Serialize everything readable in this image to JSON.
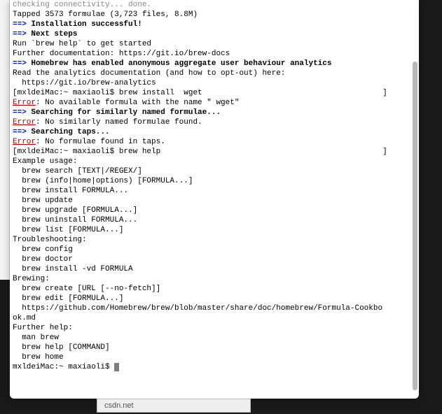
{
  "lines": [
    {
      "segs": [
        {
          "cls": "gray",
          "text": "checking connectivity... done."
        }
      ]
    },
    {
      "segs": [
        {
          "cls": "",
          "text": "Tapped 3573 formulae (3,723 files, 8.8M)"
        }
      ]
    },
    {
      "segs": [
        {
          "cls": "blue-bold",
          "text": "==> "
        },
        {
          "cls": "bold",
          "text": "Installation successful!"
        }
      ]
    },
    {
      "segs": [
        {
          "cls": "blue-bold",
          "text": "==> "
        },
        {
          "cls": "bold",
          "text": "Next steps"
        }
      ]
    },
    {
      "segs": [
        {
          "cls": "",
          "text": "Run `brew help` to get started"
        }
      ]
    },
    {
      "segs": [
        {
          "cls": "",
          "text": "Further documentation: https://git.io/brew-docs"
        }
      ]
    },
    {
      "segs": [
        {
          "cls": "blue-bold",
          "text": "==> "
        },
        {
          "cls": "bold",
          "text": "Homebrew has enabled anonymous aggregate user behaviour analytics"
        }
      ]
    },
    {
      "segs": [
        {
          "cls": "",
          "text": "Read the analytics documentation (and how to opt-out) here:"
        }
      ]
    },
    {
      "segs": [
        {
          "cls": "",
          "text": "  https://git.io/brew-analytics"
        }
      ]
    },
    {
      "segs": [
        {
          "cls": "",
          "text": "[mxldeiMac:~ maxiaoli$ brew install  wget                                       ]"
        }
      ]
    },
    {
      "segs": [
        {
          "cls": "err",
          "text": "Error"
        },
        {
          "cls": "",
          "text": ": No available formula with the name \" wget\" "
        }
      ]
    },
    {
      "segs": [
        {
          "cls": "blue-bold",
          "text": "==> "
        },
        {
          "cls": "bold",
          "text": "Searching for similarly named formulae..."
        }
      ]
    },
    {
      "segs": [
        {
          "cls": "err",
          "text": "Error"
        },
        {
          "cls": "",
          "text": ": No similarly named formulae found."
        }
      ]
    },
    {
      "segs": [
        {
          "cls": "blue-bold",
          "text": "==> "
        },
        {
          "cls": "bold",
          "text": "Searching taps..."
        }
      ]
    },
    {
      "segs": [
        {
          "cls": "err",
          "text": "Error"
        },
        {
          "cls": "",
          "text": ": No formulae found in taps."
        }
      ]
    },
    {
      "segs": [
        {
          "cls": "",
          "text": "[mxldeiMac:~ maxiaoli$ brew help                                                ]"
        }
      ]
    },
    {
      "segs": [
        {
          "cls": "",
          "text": "Example usage:"
        }
      ]
    },
    {
      "segs": [
        {
          "cls": "",
          "text": "  brew search [TEXT|/REGEX/]"
        }
      ]
    },
    {
      "segs": [
        {
          "cls": "",
          "text": "  brew (info|home|options) [FORMULA...]"
        }
      ]
    },
    {
      "segs": [
        {
          "cls": "",
          "text": "  brew install FORMULA..."
        }
      ]
    },
    {
      "segs": [
        {
          "cls": "",
          "text": "  brew update"
        }
      ]
    },
    {
      "segs": [
        {
          "cls": "",
          "text": "  brew upgrade [FORMULA...]"
        }
      ]
    },
    {
      "segs": [
        {
          "cls": "",
          "text": "  brew uninstall FORMULA..."
        }
      ]
    },
    {
      "segs": [
        {
          "cls": "",
          "text": "  brew list [FORMULA...]"
        }
      ]
    },
    {
      "segs": [
        {
          "cls": "",
          "text": ""
        }
      ]
    },
    {
      "segs": [
        {
          "cls": "",
          "text": "Troubleshooting:"
        }
      ]
    },
    {
      "segs": [
        {
          "cls": "",
          "text": "  brew config"
        }
      ]
    },
    {
      "segs": [
        {
          "cls": "",
          "text": "  brew doctor"
        }
      ]
    },
    {
      "segs": [
        {
          "cls": "",
          "text": "  brew install -vd FORMULA"
        }
      ]
    },
    {
      "segs": [
        {
          "cls": "",
          "text": ""
        }
      ]
    },
    {
      "segs": [
        {
          "cls": "",
          "text": "Brewing:"
        }
      ]
    },
    {
      "segs": [
        {
          "cls": "",
          "text": "  brew create [URL [--no-fetch]]"
        }
      ]
    },
    {
      "segs": [
        {
          "cls": "",
          "text": "  brew edit [FORMULA...]"
        }
      ]
    },
    {
      "segs": [
        {
          "cls": "",
          "text": "  https://github.com/Homebrew/brew/blob/master/share/doc/homebrew/Formula-Cookbo"
        }
      ]
    },
    {
      "segs": [
        {
          "cls": "",
          "text": "ok.md"
        }
      ]
    },
    {
      "segs": [
        {
          "cls": "",
          "text": ""
        }
      ]
    },
    {
      "segs": [
        {
          "cls": "",
          "text": "Further help:"
        }
      ]
    },
    {
      "segs": [
        {
          "cls": "",
          "text": "  man brew"
        }
      ]
    },
    {
      "segs": [
        {
          "cls": "",
          "text": "  brew help [COMMAND]"
        }
      ]
    },
    {
      "segs": [
        {
          "cls": "",
          "text": "  brew home"
        }
      ]
    },
    {
      "segs": [
        {
          "cls": "",
          "text": "mxldeiMac:~ maxiaoli$ "
        }
      ],
      "cursor": true
    }
  ],
  "bottom_label": "csdn.net"
}
